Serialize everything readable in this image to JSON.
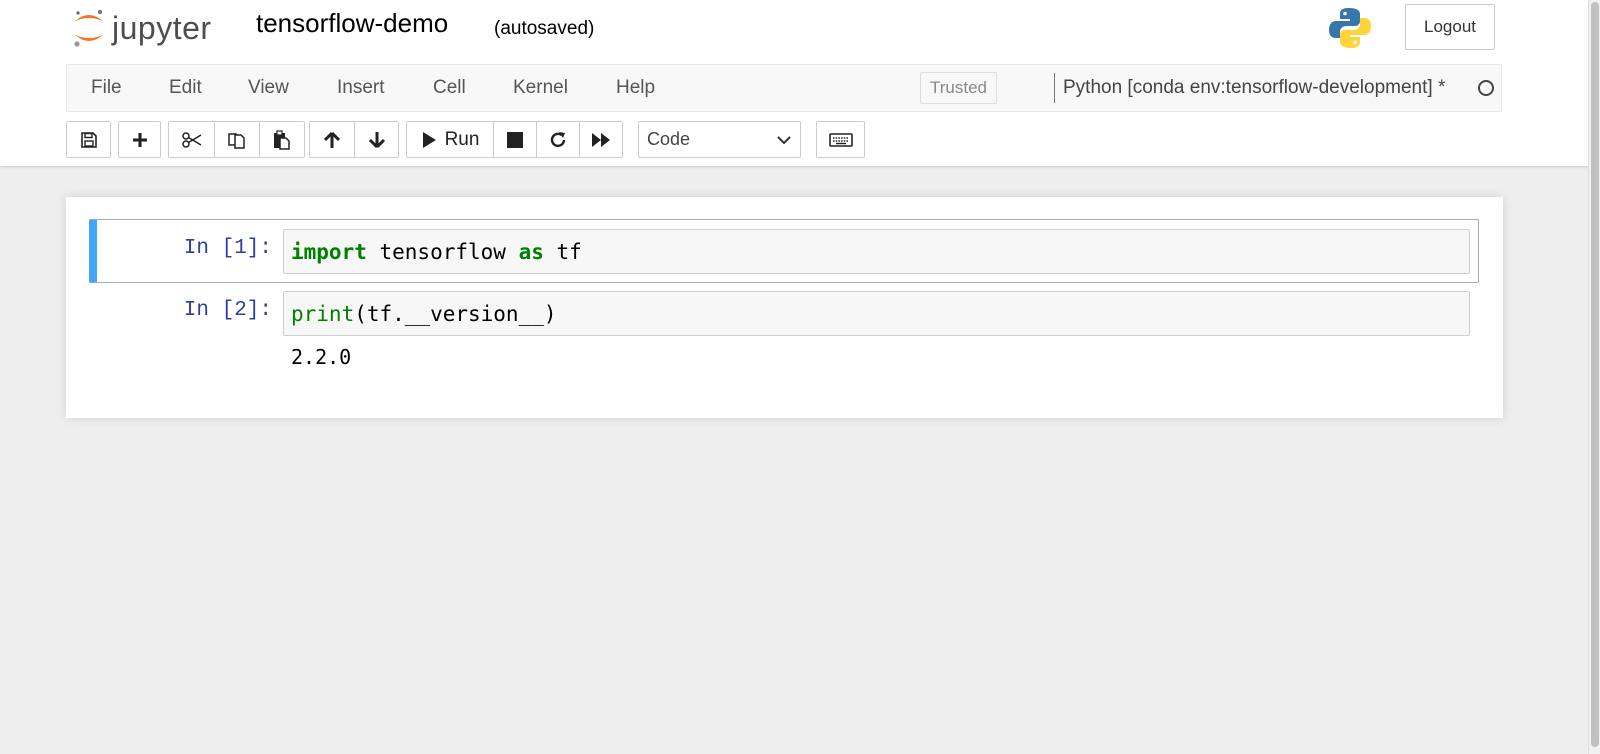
{
  "header": {
    "logo_text": "jupyter",
    "notebook_name": "tensorflow-demo",
    "autosave_status": "(autosaved)",
    "logout_label": "Logout"
  },
  "menubar": {
    "items": [
      {
        "label": "File"
      },
      {
        "label": "Edit"
      },
      {
        "label": "View"
      },
      {
        "label": "Insert"
      },
      {
        "label": "Cell"
      },
      {
        "label": "Kernel"
      },
      {
        "label": "Help"
      }
    ],
    "trusted_label": "Trusted",
    "kernel_name": "Python [conda env:tensorflow-development] *"
  },
  "toolbar": {
    "run_label": "Run",
    "cell_type": "Code",
    "icons": [
      "save-icon",
      "plus-icon",
      "cut-icon",
      "copy-icon",
      "paste-icon",
      "arrow-up-icon",
      "arrow-down-icon",
      "play-icon",
      "stop-icon",
      "restart-icon",
      "fast-forward-icon",
      "keyboard-icon"
    ]
  },
  "cells": [
    {
      "prompt": "In [1]:",
      "code": [
        {
          "text": "import",
          "style": "kw"
        },
        {
          "text": " tensorflow ",
          "style": ""
        },
        {
          "text": "as",
          "style": "kw"
        },
        {
          "text": " tf",
          "style": ""
        }
      ],
      "output": null
    },
    {
      "prompt": "In [2]:",
      "code": [
        {
          "text": "print",
          "style": "bi"
        },
        {
          "text": "(tf.__version__)",
          "style": ""
        }
      ],
      "output": "2.2.0"
    }
  ],
  "colors": {
    "selected_cell_bar": "#42a5f5",
    "prompt": "#303f9f",
    "keyword": "#008000",
    "jupyter_orange": "#f37726"
  }
}
